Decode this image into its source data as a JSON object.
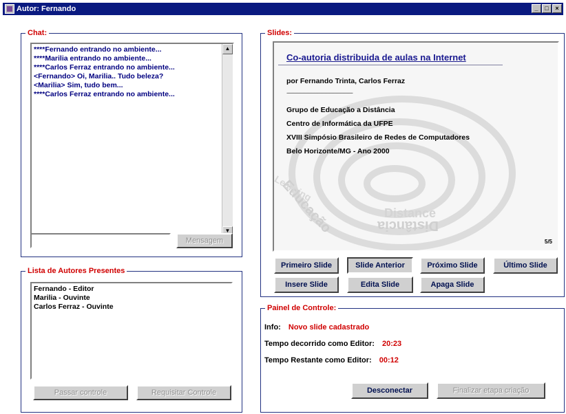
{
  "window": {
    "title": "Autor: Fernando"
  },
  "chat": {
    "legend": "Chat:",
    "messages": [
      "****Fernando entrando no ambiente...",
      "****Marilia entrando no ambiente...",
      "****Carlos Ferraz entrando no ambiente...",
      "<Fernando> Oi, Marilia.. Tudo beleza?",
      "<Marilia> Sim, tudo bem...",
      "****Carlos Ferraz entrando no ambiente..."
    ],
    "input_value": "",
    "send_label": "Mensagem"
  },
  "slides": {
    "legend": "Slides:",
    "slide": {
      "title": "Co-autoria distribuida de aulas na Internet",
      "authors": "por Fernando Trinta, Carlos Ferraz",
      "separator": "------------------------------------------------",
      "lines": [
        "Grupo de Educação a Distância",
        "Centro de Informática da UFPE",
        "XVIII Simpósio Brasileiro de Redes de Computadores",
        "Belo Horizonte/MG - Ano 2000"
      ],
      "watermark_words": [
        "Educação",
        "Learning",
        "Distance",
        "Distância"
      ],
      "page_counter": "5/5"
    },
    "nav_buttons": {
      "first": "Primeiro Slide",
      "prev": "Slide Anterior",
      "next": "Próximo Slide",
      "last": "Último Slide"
    },
    "edit_buttons": {
      "insert": "Insere Slide",
      "edit": "Edita Slide",
      "delete": "Apaga Slide"
    }
  },
  "authors": {
    "legend": "Lista de Autores Presentes",
    "list": [
      "Fernando - Editor",
      "Marilia - Ouvinte",
      "Carlos Ferraz - Ouvinte"
    ],
    "pass_control": "Passar controle",
    "request_control": "Requisitar Controle"
  },
  "control_panel": {
    "legend": "Painel de Controle:",
    "info_label": "Info:",
    "info_value": "Novo slide cadastrado",
    "elapsed_label": "Tempo decorrido como Editor:",
    "elapsed_value": "20:23",
    "remaining_label": "Tempo Restante como Editor:",
    "remaining_value": "00:12",
    "disconnect": "Desconectar",
    "finish": "Finalizar etapa criação"
  },
  "colors": {
    "title_bar": "#0a1a80",
    "legend": "#d00000",
    "chat_text": "#000080"
  }
}
